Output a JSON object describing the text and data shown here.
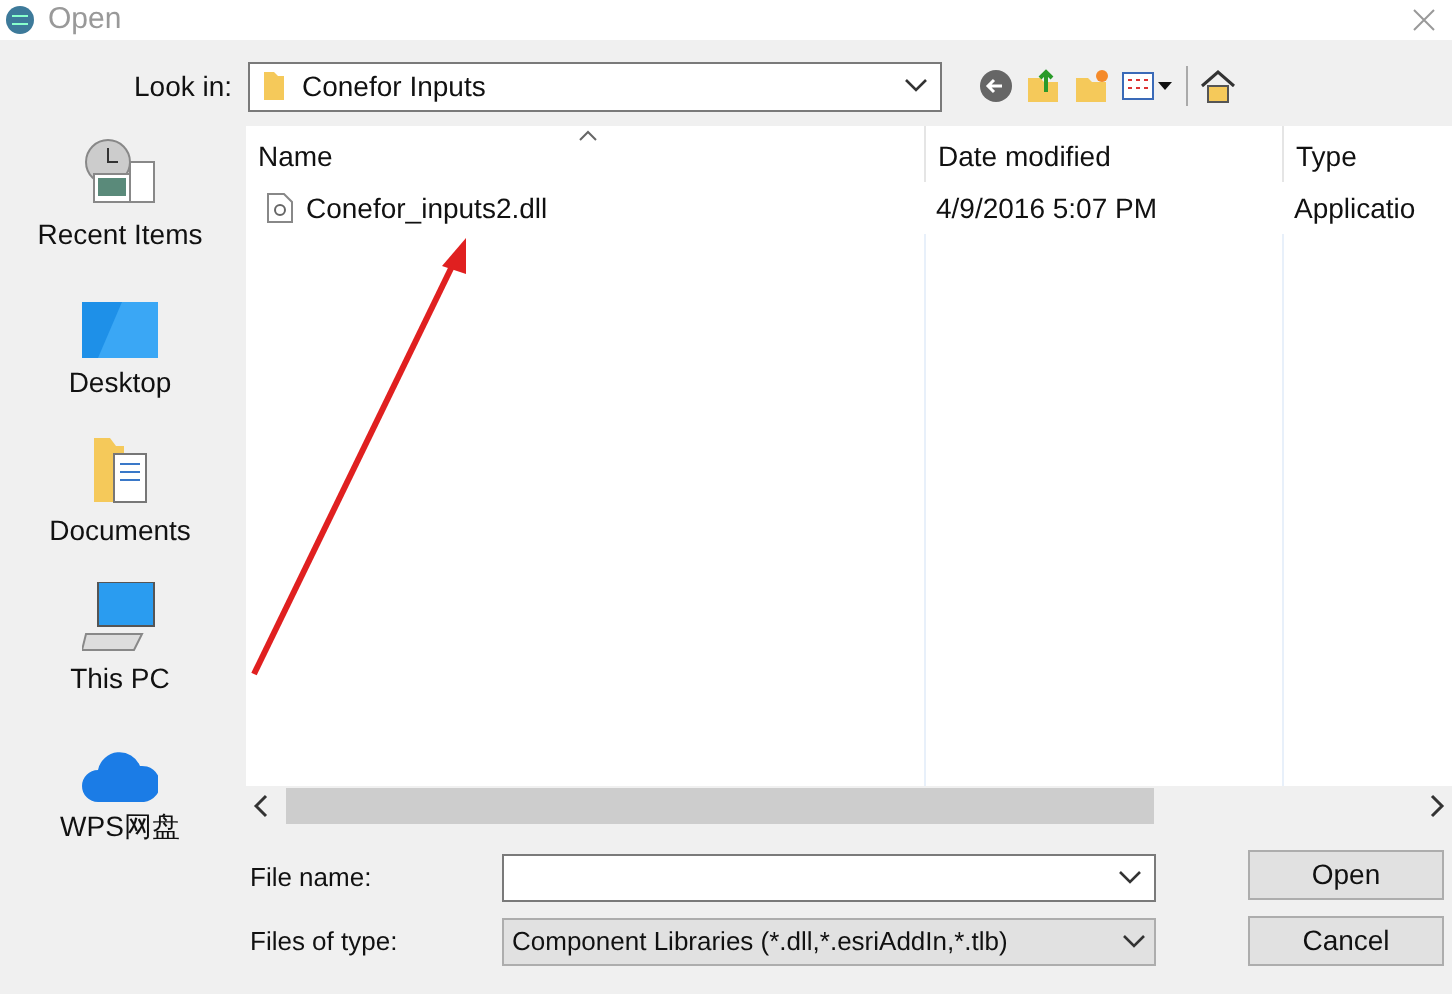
{
  "window": {
    "title": "Open"
  },
  "look_in": {
    "label": "Look in:",
    "value": "Conefor Inputs"
  },
  "places": [
    {
      "label": "Recent Items",
      "kind": "recent"
    },
    {
      "label": "Desktop",
      "kind": "desktop"
    },
    {
      "label": "Documents",
      "kind": "documents"
    },
    {
      "label": "This PC",
      "kind": "pc"
    },
    {
      "label": "WPS网盘",
      "kind": "cloud"
    }
  ],
  "table": {
    "columns": [
      "Name",
      "Date modified",
      "Type"
    ],
    "rows": [
      {
        "name": "Conefor_inputs2.dll",
        "date": "4/9/2016 5:07 PM",
        "type": "Applicatio"
      }
    ]
  },
  "file_name": {
    "label": "File name:"
  },
  "file_type": {
    "label": "Files of type:",
    "value": "Component Libraries (*.dll,*.esriAddIn,*.tlb)"
  },
  "buttons": [
    "Open",
    "Cancel"
  ]
}
